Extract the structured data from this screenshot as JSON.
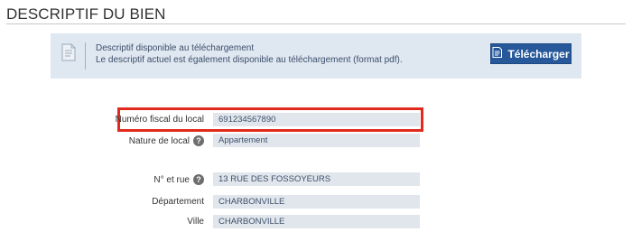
{
  "section": {
    "title": "DESCRIPTIF DU BIEN"
  },
  "info_box": {
    "icon": "document-icon",
    "line1": "Descriptif disponible au téléchargement",
    "line2": "Le descriptif actuel est également disponible au téléchargement (format pdf).",
    "download_button": {
      "icon": "file-icon",
      "label": "Télécharger"
    }
  },
  "fields": [
    {
      "label": "Numéro fiscal du local",
      "value": "691234567890",
      "help": false,
      "highlighted": true
    },
    {
      "label": "Nature de local",
      "value": "Appartement",
      "help": true
    },
    {
      "label": "N° et rue",
      "value": "13 RUE DES FOSSOYEURS",
      "help": true
    },
    {
      "label": "Département",
      "value": "CHARBONVILLE",
      "help": false
    },
    {
      "label": "Ville",
      "value": "CHARBONVILLE",
      "help": false
    }
  ],
  "colors": {
    "highlight_border": "#e02a1c",
    "button_bg": "#26589a",
    "info_bg": "#dfe7f1",
    "field_bg": "#e1e6ec"
  }
}
